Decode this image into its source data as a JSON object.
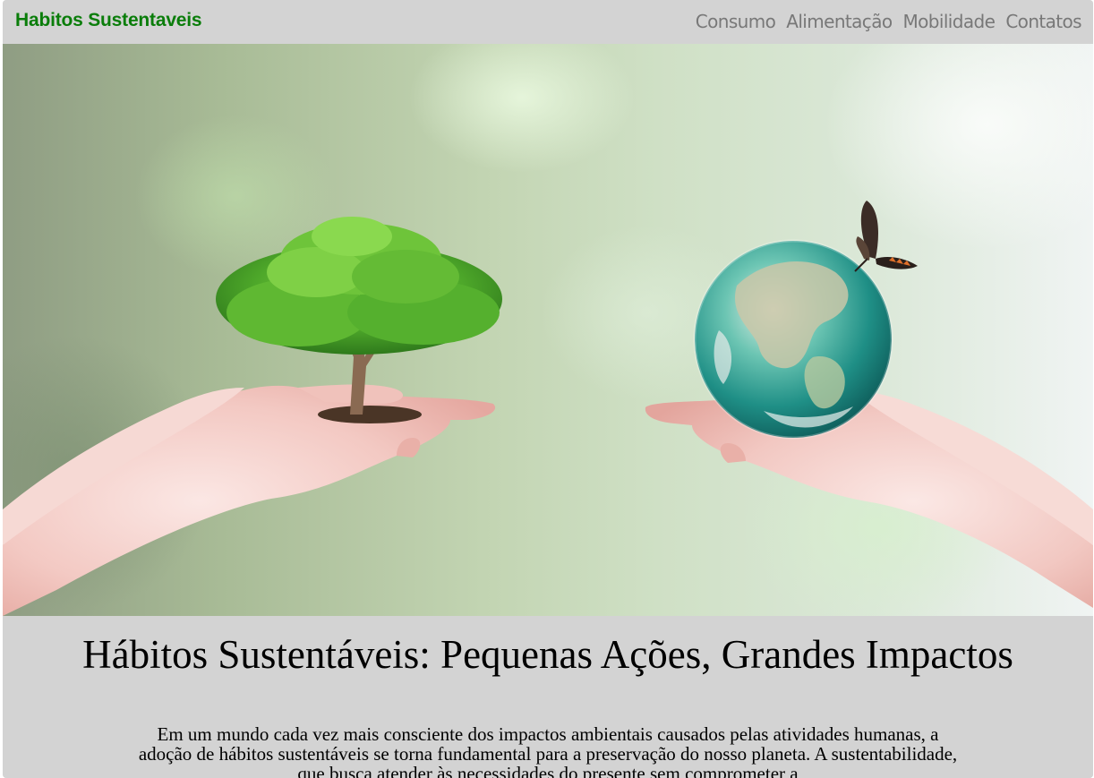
{
  "navbar": {
    "brand": "Habitos Sustentaveis",
    "links": [
      "Consumo",
      "Alimentação",
      "Mobilidade",
      "Contatos"
    ]
  },
  "hero": {
    "image_icon": "hands-holding-tree-and-earth-image"
  },
  "content": {
    "headline": "Hábitos Sustentáveis: Pequenas Ações, Grandes Impactos",
    "intro": "Em um mundo cada vez mais consciente dos impactos ambientais causados pelas atividades humanas, a adoção de hábitos sustentáveis se torna fundamental para a preservação do nosso planeta. A sustentabilidade, que busca atender às necessidades do presente sem comprometer a"
  },
  "colors": {
    "brand": "#0a7d0a",
    "nav_link": "#787878",
    "background": "#d3d3d3"
  }
}
